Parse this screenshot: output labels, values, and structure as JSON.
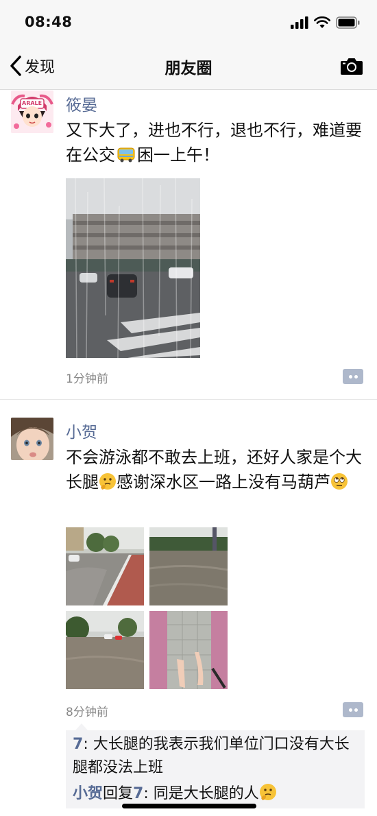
{
  "status": {
    "time": "08:48"
  },
  "nav": {
    "back_label": "发现",
    "title": "朋友圈"
  },
  "posts": [
    {
      "author": "筱晏",
      "avatar_badge": "ARALE",
      "text_part1": "又下大了，进也不行，退也不行，难道要在公交",
      "text_part2": "困一上午！",
      "emoji": "bus-emoji",
      "time": "1分钟前"
    },
    {
      "author": "小贺",
      "text_part1": "不会游泳都不敢去上班，还好人家是个大长腿",
      "text_part2": "感谢深水区一路上没有马葫芦",
      "emoji1": "thinking-face-emoji",
      "emoji2": "rolling-eyes-emoji",
      "time": "8分钟前",
      "comments": [
        {
          "user": "7",
          "sep": ": ",
          "text": "大长腿的我表示我们单位门口没有大长腿都没法上班"
        },
        {
          "user": "小贺",
          "reply_word": "回复",
          "target": "7",
          "sep": ": ",
          "text": "同是大长腿的人",
          "emoji": "thinking-face-emoji"
        }
      ]
    }
  ],
  "colors": {
    "link": "#576b95",
    "bar": "#f7f7f7",
    "comment_bg": "#f3f3f5"
  }
}
